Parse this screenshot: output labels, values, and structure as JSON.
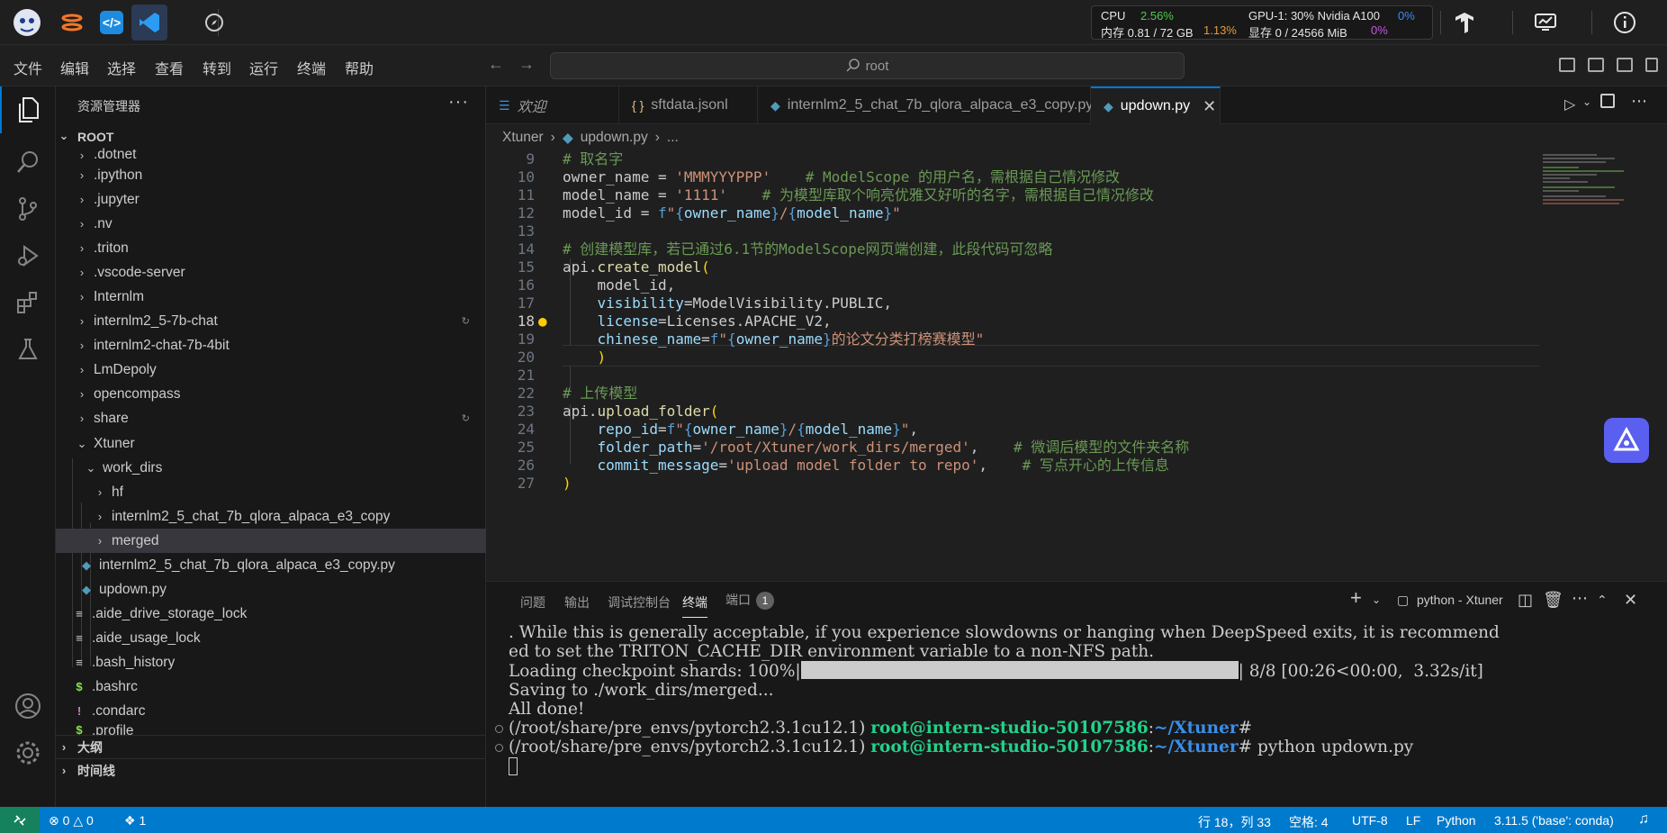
{
  "topbar": {
    "monitor": {
      "cpu_label": "CPU",
      "cpu_value": "2.56%",
      "mem_label": "内存 0.81 / 72 GB",
      "mem_value": "1.13%",
      "gpu_label": "GPU-1: 30% Nvidia A100",
      "gpu_value": "0%",
      "vram_label": "显存 0 / 24566 MiB",
      "vram_value": "0%"
    }
  },
  "menubar": {
    "items": [
      "文件",
      "编辑",
      "选择",
      "查看",
      "转到",
      "运行",
      "终端",
      "帮助"
    ],
    "search_text": "root"
  },
  "sidebar": {
    "title": "资源管理器",
    "more": "···",
    "root_label": "ROOT",
    "items": [
      {
        "label": ".dotnet",
        "kind": "folder"
      },
      {
        "label": ".ipython",
        "kind": "folder"
      },
      {
        "label": ".jupyter",
        "kind": "folder"
      },
      {
        "label": ".nv",
        "kind": "folder"
      },
      {
        "label": ".triton",
        "kind": "folder"
      },
      {
        "label": ".vscode-server",
        "kind": "folder"
      },
      {
        "label": "Internlm",
        "kind": "folder"
      },
      {
        "label": "internlm2_5-7b-chat",
        "kind": "folder"
      },
      {
        "label": "internlm2-chat-7b-4bit",
        "kind": "folder"
      },
      {
        "label": "LmDepoly",
        "kind": "folder"
      },
      {
        "label": "opencompass",
        "kind": "folder"
      },
      {
        "label": "share",
        "kind": "folder"
      },
      {
        "label": "Xtuner",
        "kind": "folder-open"
      },
      {
        "label": "work_dirs",
        "kind": "folder-open"
      },
      {
        "label": "hf",
        "kind": "folder"
      },
      {
        "label": "internlm2_5_chat_7b_qlora_alpaca_e3_copy",
        "kind": "folder"
      },
      {
        "label": "merged",
        "kind": "folder"
      },
      {
        "label": "internlm2_5_chat_7b_qlora_alpaca_e3_copy.py",
        "kind": "python"
      },
      {
        "label": "updown.py",
        "kind": "python"
      },
      {
        "label": ".aide_drive_storage_lock",
        "kind": "text"
      },
      {
        "label": ".aide_usage_lock",
        "kind": "text"
      },
      {
        "label": ".bash_history",
        "kind": "text"
      },
      {
        "label": ".bashrc",
        "kind": "shell"
      },
      {
        "label": ".condarc",
        "kind": "yaml"
      },
      {
        "label": ".profile",
        "kind": "shell"
      }
    ],
    "outline_label": "大纲",
    "timeline_label": "时间线"
  },
  "tabs": [
    {
      "label": "欢迎",
      "icon": "vscode-icon"
    },
    {
      "label": "sftdata.jsonl",
      "icon": "json-icon"
    },
    {
      "label": "internlm2_5_chat_7b_qlora_alpaca_e3_copy.py",
      "icon": "python-icon"
    },
    {
      "label": "updown.py",
      "icon": "python-icon",
      "active": true
    }
  ],
  "breadcrumb": {
    "folder": "Xtuner",
    "file": "updown.py",
    "ellipsis": "..."
  },
  "editor": {
    "line_numbers": [
      "9",
      "10",
      "11",
      "12",
      "13",
      "14",
      "15",
      "16",
      "17",
      "18",
      "19",
      "20",
      "21",
      "22",
      "23",
      "24",
      "25",
      "26",
      "27"
    ],
    "current_line": "18"
  },
  "panel": {
    "tabs": [
      "问题",
      "输出",
      "调试控制台",
      "终端",
      "端口"
    ],
    "ports_badge": "1",
    "terminal_name": "python - Xtuner",
    "terminal": {
      "l1": ". While this is generally acceptable, if you experience slowdowns or hanging when DeepSpeed exits, it is recommend",
      "l2": "ed to set the TRITON_CACHE_DIR environment variable to a non-NFS path.",
      "l3_prefix": "Loading checkpoint shards: 100%|",
      "l3_suffix": "| 8/8 [00:26<00:00,  3.32s/it]",
      "progress": 1.0,
      "l4": "Saving to ./work_dirs/merged...",
      "l5": "All done!",
      "env": "(/root/share/pre_envs/pytorch2.3.1cu12.1)",
      "host": "root@intern-studio-50107586",
      "path": "~/Xtuner",
      "hash": "#",
      "command": "python updown.py"
    }
  },
  "statusbar": {
    "errors": "0",
    "warnings": "0",
    "ports": "1",
    "position": "行 18，列 33",
    "spaces": "空格: 4",
    "encoding": "UTF-8",
    "eol": "LF",
    "language": "Python",
    "interpreter": "3.11.5 ('base': conda)"
  },
  "colors": {
    "status_bg": "#007acc",
    "accent": "#0078d4",
    "comment": "#6a9955",
    "string": "#ce9178"
  }
}
